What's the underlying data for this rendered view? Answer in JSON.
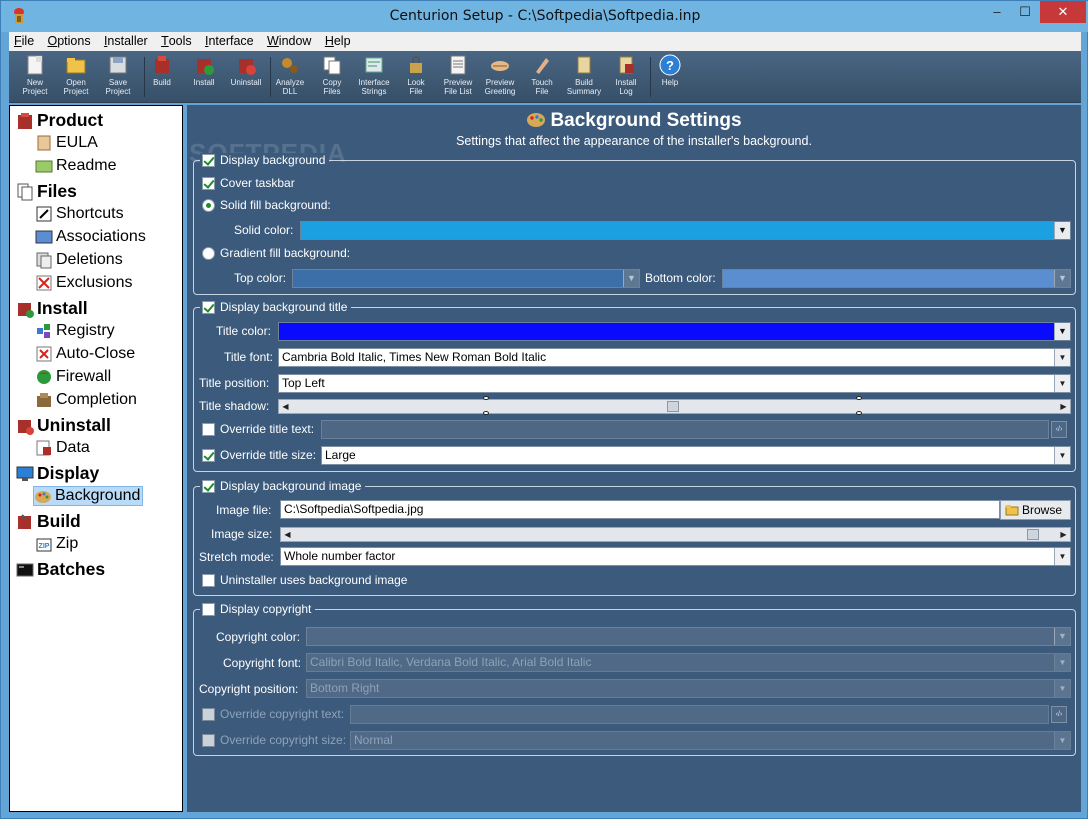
{
  "window": {
    "title": "Centurion Setup - C:\\Softpedia\\Softpedia.inp",
    "min": "–",
    "max": "☐",
    "close": "✕"
  },
  "menu": [
    {
      "key": "F",
      "rest": "ile"
    },
    {
      "key": "O",
      "rest": "ptions"
    },
    {
      "key": "I",
      "rest": "nstaller"
    },
    {
      "key": "T",
      "rest": "ools"
    },
    {
      "key": "I",
      "rest": "nterface"
    },
    {
      "key": "W",
      "rest": "indow"
    },
    {
      "key": "H",
      "rest": "elp"
    }
  ],
  "toolbar": {
    "new_project": [
      "New",
      "Project"
    ],
    "open_project": [
      "Open",
      "Project"
    ],
    "save_project": [
      "Save",
      "Project"
    ],
    "build": [
      "Build"
    ],
    "install": [
      "Install"
    ],
    "uninstall": [
      "Uninstall"
    ],
    "analyze_dll": [
      "Analyze",
      "DLL"
    ],
    "copy_files": [
      "Copy",
      "Files"
    ],
    "interface_strings": [
      "Interface",
      "Strings"
    ],
    "look_file": [
      "Look",
      "File"
    ],
    "preview_file_list": [
      "Preview",
      "File List"
    ],
    "preview_greeting": [
      "Preview",
      "Greeting"
    ],
    "touch_file": [
      "Touch",
      "File"
    ],
    "build_summary": [
      "Build",
      "Summary"
    ],
    "install_log": [
      "Install",
      "Log"
    ],
    "help": [
      "Help"
    ]
  },
  "sidebar": {
    "product": "Product",
    "eula": "EULA",
    "readme": "Readme",
    "files": "Files",
    "shortcuts": "Shortcuts",
    "associations": "Associations",
    "deletions": "Deletions",
    "exclusions": "Exclusions",
    "install": "Install",
    "registry": "Registry",
    "autoclose": "Auto-Close",
    "firewall": "Firewall",
    "completion": "Completion",
    "uninstall": "Uninstall",
    "data": "Data",
    "display": "Display",
    "background": "Background",
    "build": "Build",
    "zip": "Zip",
    "batches": "Batches"
  },
  "page": {
    "title": "Background Settings",
    "subtitle": "Settings that affect the appearance of the installer's background.",
    "watermark": "SOFTPEDIA"
  },
  "bg": {
    "display_background": "Display background",
    "cover_taskbar": "Cover taskbar",
    "solid_fill": "Solid fill background:",
    "solid_color": "Solid color:",
    "gradient_fill": "Gradient fill background:",
    "top_color": "Top color:",
    "bottom_color": "Bottom color:"
  },
  "title_group": {
    "display_title": "Display background title",
    "title_color": "Title color:",
    "title_font": "Title font:",
    "title_font_value": "Cambria Bold Italic, Times New Roman Bold Italic",
    "title_position": "Title position:",
    "title_position_value": "Top Left",
    "title_shadow": "Title shadow:",
    "override_text": "Override title text:",
    "override_size": "Override title size:",
    "override_size_value": "Large"
  },
  "image_group": {
    "display_image": "Display background image",
    "image_file": "Image file:",
    "image_file_value": "C:\\Softpedia\\Softpedia.jpg",
    "browse": "Browse",
    "image_size": "Image size:",
    "stretch_mode": "Stretch mode:",
    "stretch_mode_value": "Whole number factor",
    "uninstaller_uses": "Uninstaller uses background image"
  },
  "copyright_group": {
    "display_copyright": "Display copyright",
    "copyright_color": "Copyright color:",
    "copyright_font": "Copyright font:",
    "copyright_font_value": "Calibri Bold Italic, Verdana Bold Italic, Arial Bold Italic",
    "copyright_position": "Copyright position:",
    "copyright_position_value": "Bottom Right",
    "override_text": "Override copyright text:",
    "override_size": "Override copyright size:",
    "override_size_value": "Normal"
  },
  "colors": {
    "solid": "#1ba1e2",
    "top": "#3c6fa8",
    "bottom": "#5b8ed1",
    "title": "#0a0aff",
    "accent_checkbox": "#1d8c2a"
  }
}
